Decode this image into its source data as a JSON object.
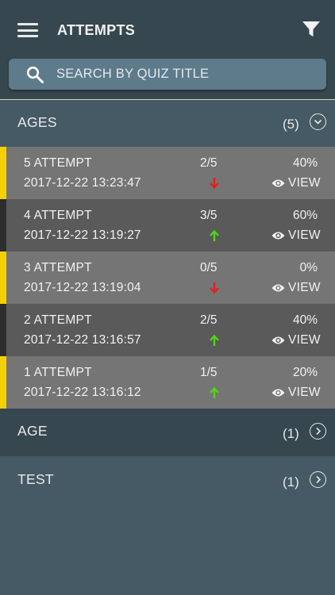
{
  "appbar": {
    "title": "ATTEMPTS",
    "menu_icon": "hamburger-menu-icon",
    "filter_icon": "filter-funnel-icon"
  },
  "search": {
    "placeholder": "SEARCH BY QUIZ TITLE",
    "icon": "search-icon"
  },
  "colors": {
    "background": "#455a64",
    "appbar": "#37474f",
    "row_light": "#757575",
    "row_dark": "#5a5a5a",
    "stripe_yellow": "#f5d000",
    "stripe_dark": "#2d2d2d",
    "arrow_up": "#4fd617",
    "arrow_down": "#e02020"
  },
  "groups": [
    {
      "title": "AGES",
      "count": "(5)",
      "expanded": true
    },
    {
      "title": "AGE",
      "count": "(1)",
      "expanded": false
    },
    {
      "title": "TEST",
      "count": "(1)",
      "expanded": false
    }
  ],
  "attempts": [
    {
      "name": "5 ATTEMPT",
      "date": "2017-12-22 13:23:47",
      "score": "2/5",
      "trend": "down",
      "percent": "40%",
      "view_label": "VIEW"
    },
    {
      "name": "4 ATTEMPT",
      "date": "2017-12-22 13:19:27",
      "score": "3/5",
      "trend": "up",
      "percent": "60%",
      "view_label": "VIEW"
    },
    {
      "name": "3 ATTEMPT",
      "date": "2017-12-22 13:19:04",
      "score": "0/5",
      "trend": "down",
      "percent": "0%",
      "view_label": "VIEW"
    },
    {
      "name": "2 ATTEMPT",
      "date": "2017-12-22 13:16:57",
      "score": "2/5",
      "trend": "up",
      "percent": "40%",
      "view_label": "VIEW"
    },
    {
      "name": "1 ATTEMPT",
      "date": "2017-12-22 13:16:12",
      "score": "1/5",
      "trend": "up",
      "percent": "20%",
      "view_label": "VIEW"
    }
  ]
}
